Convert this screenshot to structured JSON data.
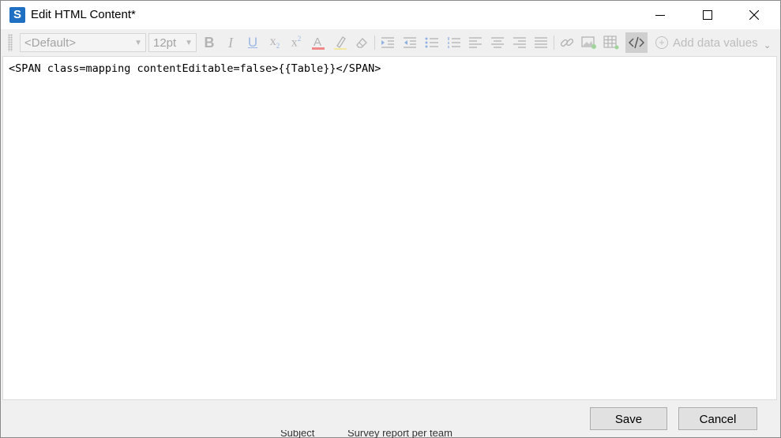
{
  "window": {
    "title": "Edit HTML Content*",
    "app_icon_glyph": "S",
    "controls": [
      "minimize-icon",
      "maximize-icon",
      "close-icon"
    ]
  },
  "toolbar": {
    "font_family": "<Default>",
    "font_size": "12pt",
    "add_data_values_label": "Add data values",
    "buttons": [
      "bold-icon",
      "italic-icon",
      "underline-icon",
      "subscript-icon",
      "superscript-icon",
      "font-color-icon",
      "highlight-icon",
      "eraser-icon",
      "indent-icon",
      "outdent-icon",
      "bullet-list-icon",
      "numbered-list-icon",
      "align-left-icon",
      "align-center-icon",
      "align-right-icon",
      "justify-icon",
      "link-icon",
      "image-icon",
      "table-icon",
      "source-code-icon"
    ],
    "active_button": "source-code-icon"
  },
  "editor": {
    "content": "<SPAN class=mapping contentEditable=false>{{Table}}</SPAN>"
  },
  "footer": {
    "save_label": "Save",
    "cancel_label": "Cancel"
  },
  "background": {
    "partial_text_1": "Subject",
    "partial_text_2": "Survey report per team"
  }
}
